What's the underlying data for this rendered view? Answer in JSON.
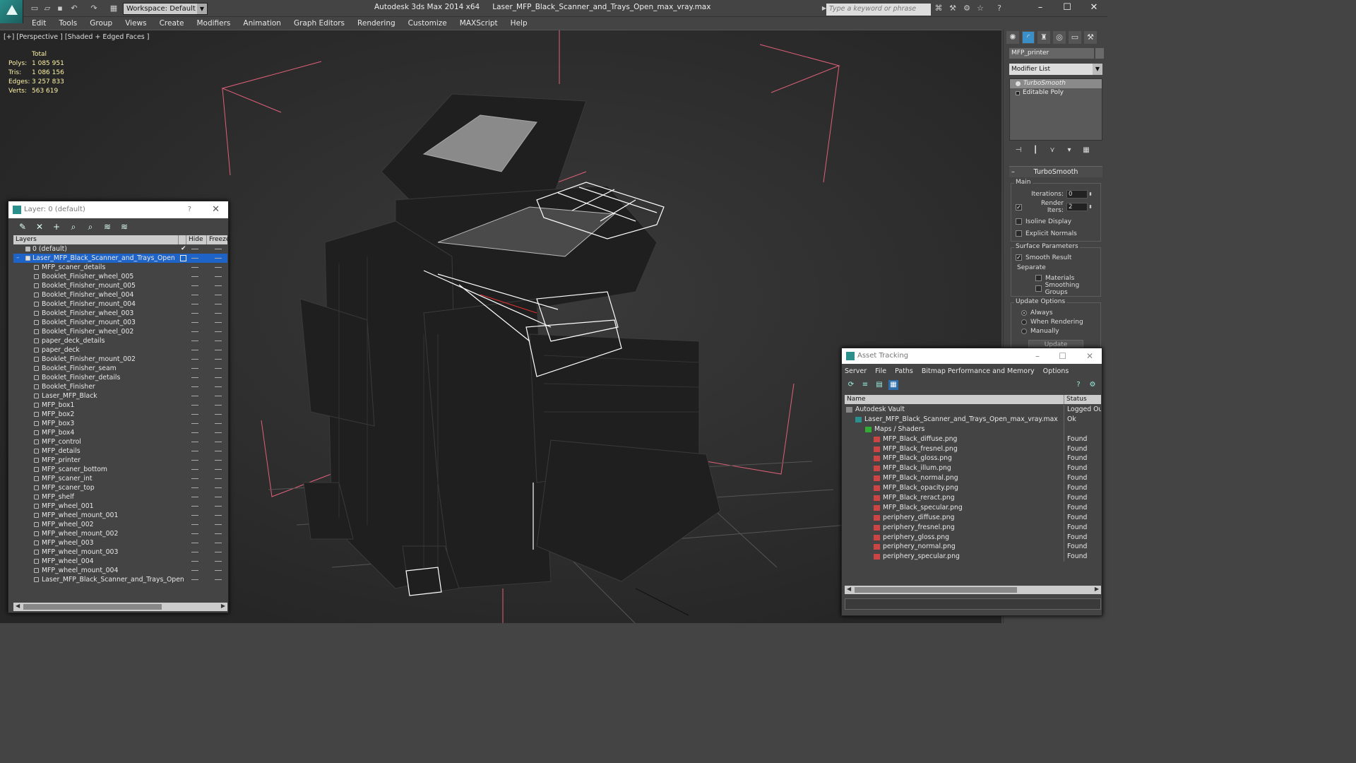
{
  "app": {
    "title": "Autodesk 3ds Max  2014 x64",
    "file": "Laser_MFP_Black_Scanner_and_Trays_Open_max_vray.max",
    "workspace": "Workspace: Default",
    "search_placeholder": "Type a keyword or phrase"
  },
  "menu": [
    "Edit",
    "Tools",
    "Group",
    "Views",
    "Create",
    "Modifiers",
    "Animation",
    "Graph Editors",
    "Rendering",
    "Customize",
    "MAXScript",
    "Help"
  ],
  "viewport": {
    "label": "[+] [Perspective ] [Shaded + Edged Faces ]",
    "stats_header": "Total",
    "stats": [
      {
        "k": "Polys:",
        "v": "1 085 951"
      },
      {
        "k": "Tris:",
        "v": "1 086 156"
      },
      {
        "k": "Edges:",
        "v": "3 257 833"
      },
      {
        "k": "Verts:",
        "v": "563 619"
      }
    ]
  },
  "command_panel": {
    "object_name": "MFP_printer",
    "modifier_list": "Modifier List",
    "stack": [
      "TurboSmooth",
      "Editable Poly"
    ],
    "rollout_title": "TurboSmooth",
    "main_group": "Main",
    "iterations_label": "Iterations:",
    "iterations_value": "0",
    "render_iters_label": "Render Iters:",
    "render_iters_value": "2",
    "isoline": "Isoline Display",
    "explicit_normals": "Explicit Normals",
    "surface_group": "Surface Parameters",
    "smooth_result": "Smooth Result",
    "separate": "Separate",
    "materials": "Materials",
    "smoothing_groups": "Smoothing Groups",
    "update_group": "Update Options",
    "always": "Always",
    "when_rendering": "When Rendering",
    "manually": "Manually",
    "update_button": "Update"
  },
  "layer_window": {
    "title": "Layer: 0 (default)",
    "help": "?",
    "col_layers": "Layers",
    "col_hide": "Hide",
    "col_freeze": "Freeze",
    "layers": [
      {
        "name": "0 (default)",
        "type": "layer"
      },
      {
        "name": "Laser_MFP_Black_Scanner_and_Trays_Open",
        "type": "selected"
      }
    ],
    "objects": [
      "MFP_scaner_details",
      "Booklet_Finisher_wheel_005",
      "Booklet_Finisher_mount_005",
      "Booklet_Finisher_wheel_004",
      "Booklet_Finisher_mount_004",
      "Booklet_Finisher_wheel_003",
      "Booklet_Finisher_mount_003",
      "Booklet_Finisher_wheel_002",
      "paper_deck_details",
      "paper_deck",
      "Booklet_Finisher_mount_002",
      "Booklet_Finisher_seam",
      "Booklet_Finisher_details",
      "Booklet_Finisher",
      "Laser_MFP_Black",
      "MFP_box1",
      "MFP_box2",
      "MFP_box3",
      "MFP_box4",
      "MFP_control",
      "MFP_details",
      "MFP_printer",
      "MFP_scaner_bottom",
      "MFP_scaner_int",
      "MFP_scaner_top",
      "MFP_shelf",
      "MFP_wheel_001",
      "MFP_wheel_mount_001",
      "MFP_wheel_002",
      "MFP_wheel_mount_002",
      "MFP_wheel_003",
      "MFP_wheel_mount_003",
      "MFP_wheel_004",
      "MFP_wheel_mount_004",
      "Laser_MFP_Black_Scanner_and_Trays_Open"
    ]
  },
  "asset_window": {
    "title": "Asset Tracking",
    "menu": [
      "Server",
      "File",
      "Paths",
      "Bitmap Performance and Memory",
      "Options"
    ],
    "col_name": "Name",
    "col_status": "Status",
    "rows": [
      {
        "name": "Autodesk Vault",
        "status": "Logged Ou",
        "level": 0,
        "kind": "vault"
      },
      {
        "name": "Laser_MFP_Black_Scanner_and_Trays_Open_max_vray.max",
        "status": "Ok",
        "level": 1,
        "kind": "max"
      },
      {
        "name": "Maps / Shaders",
        "status": "",
        "level": 2,
        "kind": "maps"
      },
      {
        "name": "MFP_Black_diffuse.png",
        "status": "Found",
        "level": 3,
        "kind": "png"
      },
      {
        "name": "MFP_Black_fresnel.png",
        "status": "Found",
        "level": 3,
        "kind": "png"
      },
      {
        "name": "MFP_Black_gloss.png",
        "status": "Found",
        "level": 3,
        "kind": "png"
      },
      {
        "name": "MFP_Black_illum.png",
        "status": "Found",
        "level": 3,
        "kind": "png"
      },
      {
        "name": "MFP_Black_normal.png",
        "status": "Found",
        "level": 3,
        "kind": "png"
      },
      {
        "name": "MFP_Black_opacity.png",
        "status": "Found",
        "level": 3,
        "kind": "png"
      },
      {
        "name": "MFP_Black_reract.png",
        "status": "Found",
        "level": 3,
        "kind": "png"
      },
      {
        "name": "MFP_Black_specular.png",
        "status": "Found",
        "level": 3,
        "kind": "png"
      },
      {
        "name": "periphery_diffuse.png",
        "status": "Found",
        "level": 3,
        "kind": "png"
      },
      {
        "name": "periphery_fresnel.png",
        "status": "Found",
        "level": 3,
        "kind": "png"
      },
      {
        "name": "periphery_gloss.png",
        "status": "Found",
        "level": 3,
        "kind": "png"
      },
      {
        "name": "periphery_normal.png",
        "status": "Found",
        "level": 3,
        "kind": "png"
      },
      {
        "name": "periphery_specular.png",
        "status": "Found",
        "level": 3,
        "kind": "png"
      }
    ]
  },
  "colors": {
    "selection": "#1e64c8",
    "stats_text": "#fff3a8",
    "bbox_lines": "#e0607a",
    "brand": "#2b8f8c"
  }
}
